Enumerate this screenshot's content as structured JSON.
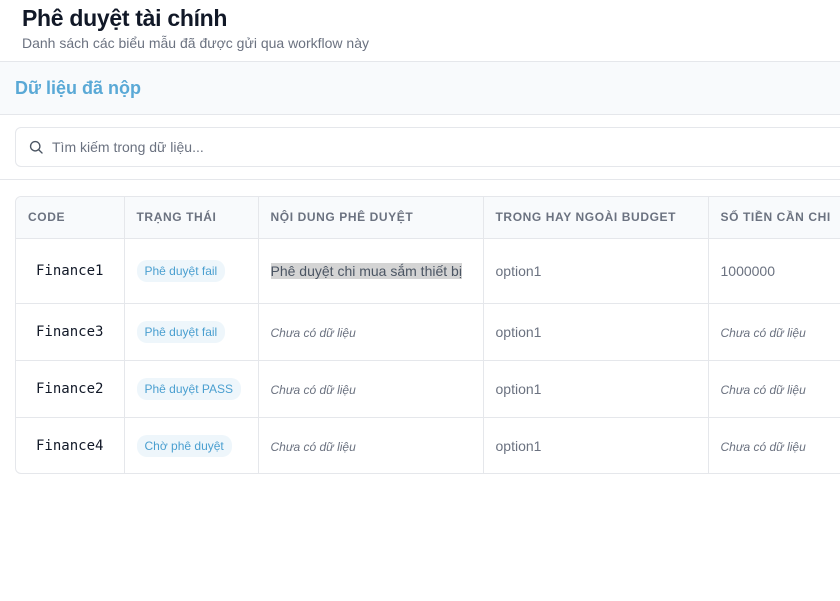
{
  "header": {
    "title": "Phê duyệt tài chính",
    "subtitle": "Danh sách các biểu mẫu đã được gửi qua workflow này"
  },
  "section": {
    "title": "Dữ liệu đã nộp"
  },
  "search": {
    "placeholder": "Tìm kiếm trong dữ liệu...",
    "value": ""
  },
  "table": {
    "columns": [
      "CODE",
      "TRẠNG THÁI",
      "NỘI DUNG PHÊ DUYỆT",
      "TRONG HAY NGOÀI BUDGET",
      "SỐ TIỀN CẦN CHI"
    ],
    "rows": [
      {
        "code": "Finance1",
        "status": "Phê duyệt fail",
        "content": "Phê duyệt chi mua sắm thiết bị",
        "budget": "option1",
        "amount": "1000000"
      },
      {
        "code": "Finance3",
        "status": "Phê duyệt fail",
        "content": "Chưa có dữ liệu",
        "budget": "option1",
        "amount": "Chưa có dữ liệu"
      },
      {
        "code": "Finance2",
        "status": "Phê duyệt PASS",
        "content": "Chưa có dữ liệu",
        "budget": "option1",
        "amount": "Chưa có dữ liệu"
      },
      {
        "code": "Finance4",
        "status": "Chờ phê duyệt",
        "content": "Chưa có dữ liệu",
        "budget": "option1",
        "amount": "Chưa có dữ liệu"
      }
    ]
  },
  "colors": {
    "accent": "#5aa9d6",
    "badge_bg": "#eef6fb",
    "badge_text": "#4a9fd0"
  }
}
